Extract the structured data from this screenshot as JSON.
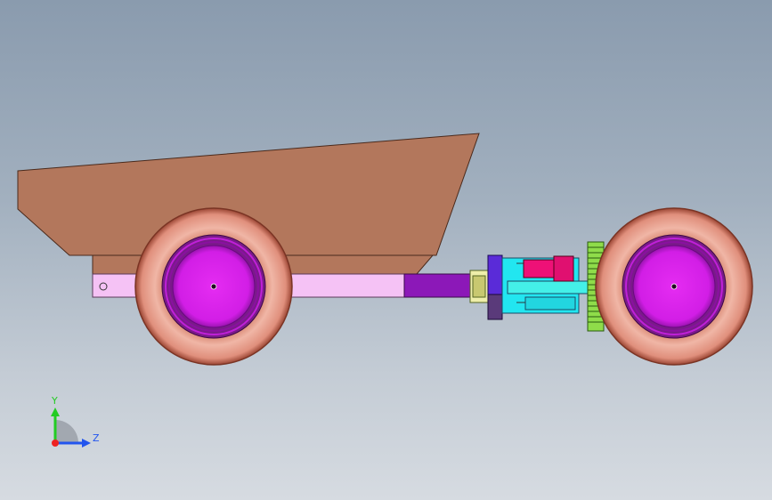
{
  "view": {
    "colors": {
      "background_top": "#8a9bae",
      "background_bottom": "#d6dbe1",
      "dump_bed": "#b3775c",
      "tire": "#e7a493",
      "tire_edge": "#8a3b2c",
      "hub": "#dd22ee",
      "hub_ring": "#8e16a8",
      "frame_rail": "#f5c2f5",
      "frame_rail_dark": "#8c18b8",
      "piston_cyan": "#22e6f0",
      "motor_magenta": "#ee1177",
      "gear_green": "#8fdc4a",
      "bracket_blue": "#5a2bd8"
    }
  },
  "triad": {
    "y_label": "Y",
    "z_label": "Z",
    "colors": {
      "y_axis": "#22cc22",
      "z_axis": "#2255ee",
      "x_axis": "#ee2222"
    }
  }
}
